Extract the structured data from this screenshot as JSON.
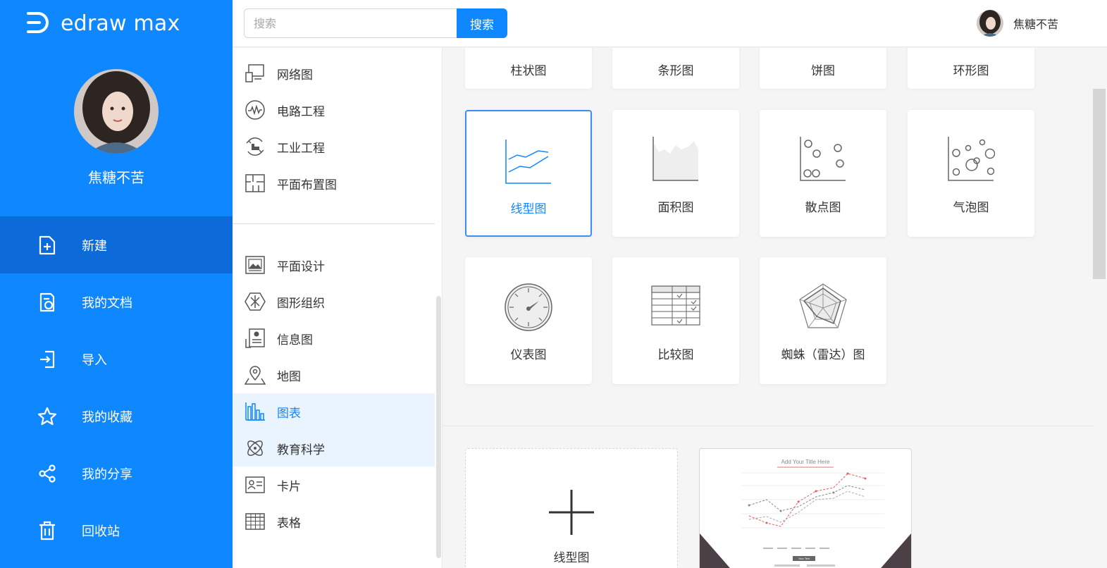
{
  "brand": {
    "name": "edraw max"
  },
  "user": {
    "name": "焦糖不苦"
  },
  "search": {
    "placeholder": "搜索",
    "button_label": "搜索"
  },
  "nav": [
    {
      "label": "新建",
      "icon": "new-file-icon",
      "active": true
    },
    {
      "label": "我的文档",
      "icon": "my-documents-icon",
      "active": false
    },
    {
      "label": "导入",
      "icon": "import-icon",
      "active": false
    },
    {
      "label": "我的收藏",
      "icon": "star-icon",
      "active": false
    },
    {
      "label": "我的分享",
      "icon": "share-icon",
      "active": false
    },
    {
      "label": "回收站",
      "icon": "trash-icon",
      "active": false
    }
  ],
  "categories_top": [
    {
      "label": "网络图",
      "icon": "network-icon"
    },
    {
      "label": "电路工程",
      "icon": "circuit-icon"
    },
    {
      "label": "工业工程",
      "icon": "industrial-icon"
    },
    {
      "label": "平面布置图",
      "icon": "floor-plan-icon"
    }
  ],
  "categories_bottom": [
    {
      "label": "平面设计",
      "icon": "graphic-design-icon",
      "active": false
    },
    {
      "label": "图形组织",
      "icon": "graphic-organizer-icon",
      "active": false
    },
    {
      "label": "信息图",
      "icon": "infographic-icon",
      "active": false
    },
    {
      "label": "地图",
      "icon": "map-pin-icon",
      "active": false
    },
    {
      "label": "图表",
      "icon": "bar-chart-icon",
      "active": true
    },
    {
      "label": "教育科学",
      "icon": "atom-icon",
      "active": false
    },
    {
      "label": "卡片",
      "icon": "card-icon",
      "active": false
    },
    {
      "label": "表格",
      "icon": "table-icon",
      "active": false
    }
  ],
  "chart_types_row1": [
    "柱状图",
    "条形图",
    "饼图",
    "环形图"
  ],
  "chart_types_row2": [
    {
      "label": "线型图",
      "icon": "line-chart-icon",
      "selected": true
    },
    {
      "label": "面积图",
      "icon": "area-chart-icon",
      "selected": false
    },
    {
      "label": "散点图",
      "icon": "scatter-chart-icon",
      "selected": false
    },
    {
      "label": "气泡图",
      "icon": "bubble-chart-icon",
      "selected": false
    }
  ],
  "chart_types_row3": [
    {
      "label": "仪表图",
      "icon": "gauge-icon"
    },
    {
      "label": "比较图",
      "icon": "comparison-table-icon"
    },
    {
      "label": "蜘蛛（雷达）图",
      "icon": "radar-chart-icon"
    }
  ],
  "templates": {
    "blank_label": "线型图",
    "preview_title": "Add Your Title Here",
    "preview_button": "Your Text"
  },
  "colors": {
    "primary": "#0f87ff",
    "nav_active": "#0c6ad9",
    "cat_active_bg": "#eaf4ff",
    "selected_border": "#3a8ef5"
  }
}
